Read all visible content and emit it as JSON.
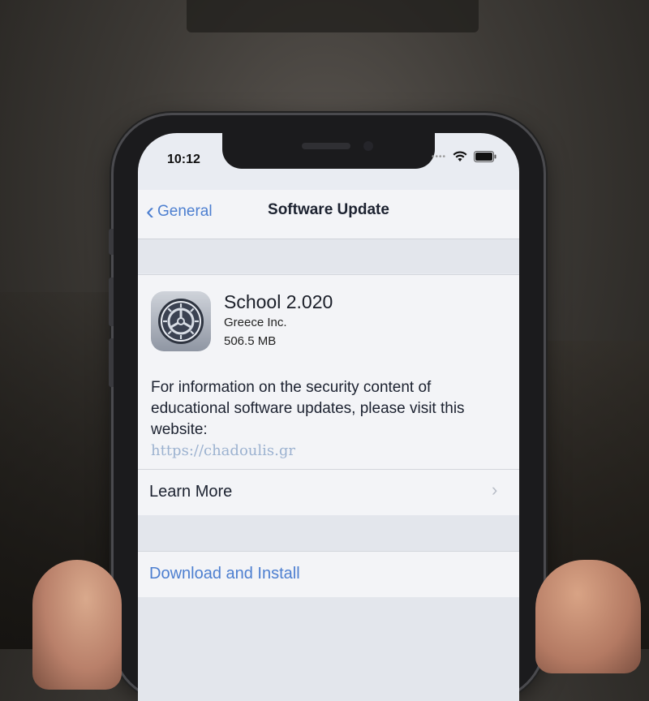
{
  "status_bar": {
    "time": "10:12",
    "signal_dots": "••••",
    "wifi_icon": "wifi-icon",
    "battery_icon": "battery-icon"
  },
  "nav": {
    "back_label": "General",
    "back_icon": "chevron-left-icon",
    "title": "Software Update"
  },
  "update": {
    "icon": "settings-gear-icon",
    "name": "School 2.020",
    "vendor": "Greece Inc.",
    "size": "506.5 MB",
    "info_text": "For information on the security content of educational software updates, please visit this website:",
    "link": "https://chadoulis.gr"
  },
  "actions": {
    "learn_more": "Learn More",
    "learn_more_icon": "chevron-right-icon",
    "download_install": "Download and Install"
  },
  "colors": {
    "accent": "#4d7fd0",
    "link": "#9cb2d0",
    "background": "#e9ecf2"
  }
}
